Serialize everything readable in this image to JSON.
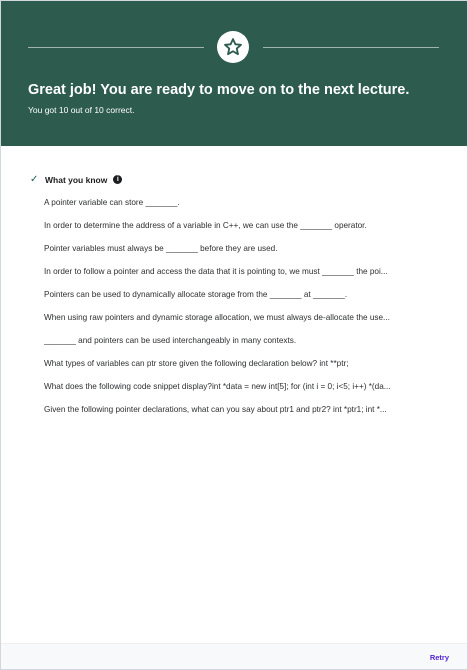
{
  "banner": {
    "headline": "Great job! You are ready to move on to the next lecture.",
    "score_text": "You got 10 out of 10 correct.",
    "background_color": "#2d5b4e",
    "icon": "star-icon"
  },
  "results": {
    "section_title": "What you know",
    "status_icon": "check-icon",
    "info_icon": "info-icon",
    "questions": [
      "A pointer variable can store _______.",
      "In order to determine the address of a variable in C++, we can use the _______ operator.",
      "Pointer variables must always be _______ before they are used.",
      "In order to follow a pointer and access the data that it is pointing to, we must _______ the poi...",
      "Pointers can be used to dynamically allocate storage from the _______ at _______.",
      "When using raw pointers and dynamic storage allocation, we must always de-allocate the use...",
      "_______ and pointers can be used interchangeably in many contexts.",
      "What types of variables can ptr store given the following declaration below? int **ptr;",
      "What does the following code snippet display?int *data = new int[5]; for (int i = 0; i<5; i++) *(da...",
      "Given the following pointer declarations, what can you say about ptr1 and ptr2? int *ptr1; int *..."
    ]
  },
  "footer": {
    "retry_label": "Retry",
    "accent_color": "#5624d0"
  }
}
